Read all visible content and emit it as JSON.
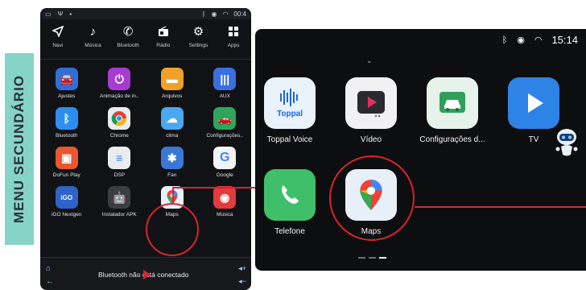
{
  "side_label": "MENU SECUNDÁRIO",
  "tablet": {
    "status": {
      "time": "00:4"
    },
    "nav": [
      {
        "label": "Navi",
        "icon": "navigation-arrow-icon"
      },
      {
        "label": "Música",
        "icon": "music-note-icon"
      },
      {
        "label": "Bluetooth",
        "icon": "phone-icon"
      },
      {
        "label": "Rádio",
        "icon": "radio-icon"
      },
      {
        "label": "Settings",
        "icon": "gear-icon"
      },
      {
        "label": "Apps",
        "icon": "apps-grid-icon"
      }
    ],
    "apps": [
      {
        "label": "Ajustes",
        "icon": "car-icon",
        "color": "#2f6fd8"
      },
      {
        "label": "Animação de in..",
        "icon": "power-icon",
        "color": "#a53bd0"
      },
      {
        "label": "Arquivos",
        "icon": "folder-icon",
        "color": "#f0a12a"
      },
      {
        "label": "AUX",
        "icon": "aux-bars-icon",
        "color": "#3b6ee0"
      },
      {
        "label": "Bluetooth",
        "icon": "bluetooth-icon",
        "color": "#2c8ff0"
      },
      {
        "label": "Chrome",
        "icon": "chrome-icon",
        "color": "#e9ecef"
      },
      {
        "label": "clima",
        "icon": "weather-icon",
        "color": "#4aa8ee"
      },
      {
        "label": "Configurações..",
        "icon": "car-settings-icon",
        "color": "#2ea65a"
      },
      {
        "label": "DoFun Play",
        "icon": "store-bag-icon",
        "color": "#e8572f"
      },
      {
        "label": "DSP",
        "icon": "dsp-icon",
        "color": "#e9ecef"
      },
      {
        "label": "Fan",
        "icon": "fan-icon",
        "color": "#3a78d6"
      },
      {
        "label": "Google",
        "icon": "google-icon",
        "color": "#f1f3f4"
      },
      {
        "label": "iGO Nextgen",
        "icon": "igo-icon",
        "color": "#2f63c8"
      },
      {
        "label": "Instalador APK",
        "icon": "android-icon",
        "color": "#3a3d42"
      },
      {
        "label": "Maps",
        "icon": "maps-pin-icon",
        "color": "#e7f0fb"
      },
      {
        "label": "Música",
        "icon": "vinyl-icon",
        "color": "#e23b3b"
      }
    ],
    "bottom_status": "Bluetooth não está conectado"
  },
  "screen": {
    "status": {
      "time": "15:14"
    },
    "apps": [
      {
        "label": "Toppal Voice",
        "icon": "toppal-voice-icon",
        "logo_text": "Toppal"
      },
      {
        "label": "Vídeo",
        "icon": "video-play-icon"
      },
      {
        "label": "Configurações d...",
        "icon": "car-settings-icon"
      },
      {
        "label": "TV",
        "icon": "tv-play-icon"
      },
      {
        "label": "Telefone",
        "icon": "phone-icon"
      },
      {
        "label": "Maps",
        "icon": "maps-pin-icon"
      }
    ]
  },
  "colors": {
    "highlight": "#d6242e",
    "label_bg": "#86d3c8"
  }
}
